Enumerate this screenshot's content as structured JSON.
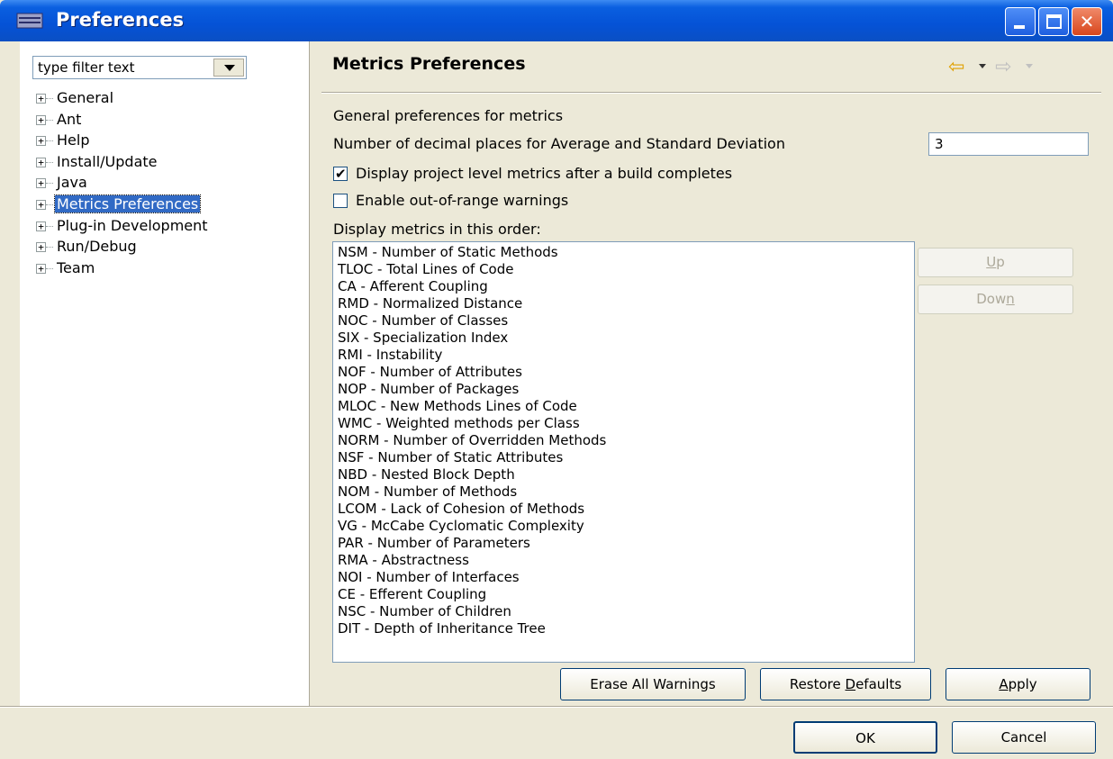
{
  "window": {
    "title": "Preferences",
    "controls": {
      "minimize": "minimize",
      "maximize": "maximize",
      "close": "✕"
    }
  },
  "sidebar": {
    "filter_text": "type filter text",
    "items": [
      {
        "label": "General",
        "selected": false
      },
      {
        "label": "Ant",
        "selected": false
      },
      {
        "label": "Help",
        "selected": false
      },
      {
        "label": "Install/Update",
        "selected": false
      },
      {
        "label": "Java",
        "selected": false
      },
      {
        "label": "Metrics Preferences",
        "selected": true
      },
      {
        "label": "Plug-in Development",
        "selected": false
      },
      {
        "label": "Run/Debug",
        "selected": false
      },
      {
        "label": "Team",
        "selected": false
      }
    ],
    "expander_glyph": "+"
  },
  "main": {
    "title": "Metrics Preferences",
    "nav": {
      "back_icon": "⇦",
      "forward_icon": "⇨"
    },
    "general_label": "General preferences for metrics",
    "decimal_label": "Number of decimal places for Average and Standard Deviation",
    "decimal_value": "3",
    "checkboxes": [
      {
        "label": "Display project level metrics after a build completes",
        "checked": true
      },
      {
        "label": "Enable out-of-range warnings",
        "checked": false
      }
    ],
    "order_label": "Display metrics in this order:",
    "metrics": [
      "NSM - Number of Static Methods",
      "TLOC - Total Lines of Code",
      "CA - Afferent Coupling",
      "RMD - Normalized Distance",
      "NOC - Number of Classes",
      "SIX - Specialization Index",
      "RMI - Instability",
      "NOF - Number of Attributes",
      "NOP - Number of Packages",
      "MLOC - New Methods Lines of Code",
      "WMC - Weighted methods per Class",
      "NORM - Number of Overridden Methods",
      "NSF - Number of Static Attributes",
      "NBD - Nested Block Depth",
      "NOM - Number of Methods",
      "LCOM - Lack of Cohesion of Methods",
      "VG - McCabe Cyclomatic Complexity",
      "PAR - Number of Parameters",
      "RMA - Abstractness",
      "NOI - Number of Interfaces",
      "CE - Efferent Coupling",
      "NSC - Number of Children",
      "DIT - Depth of Inheritance Tree"
    ],
    "up_button": {
      "pre": "",
      "mnemonic": "U",
      "post": "p"
    },
    "down_button": {
      "pre": "Dow",
      "mnemonic": "n",
      "post": ""
    },
    "erase_button": "Erase All Warnings",
    "restore_button": {
      "pre": "Restore ",
      "mnemonic": "D",
      "post": "efaults"
    },
    "apply_button": {
      "pre": "",
      "mnemonic": "A",
      "post": "pply"
    }
  },
  "footer": {
    "ok_button": "OK",
    "cancel_button": "Cancel"
  },
  "colors": {
    "titlebar": "#0552d6",
    "selection": "#316ac5",
    "dialog_bg": "#ece9d8"
  }
}
